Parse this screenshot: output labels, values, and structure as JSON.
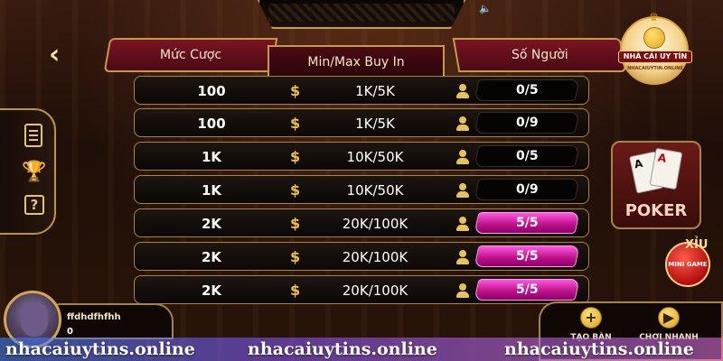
{
  "header": {
    "col_bet": "Mức Cược",
    "col_buyin": "Min/Max Buy In",
    "col_players": "Số Người"
  },
  "icons": {
    "back": "chevron-left-icon",
    "speaker": "speaker-icon",
    "document": "document-icon",
    "trophy": "trophy-icon",
    "help": "help-icon",
    "dollar": "dollar-icon",
    "person": "person-icon"
  },
  "rows": [
    {
      "bet": "100",
      "currency": "$",
      "buyin": "1K/5K",
      "players": "0/5",
      "full": false
    },
    {
      "bet": "100",
      "currency": "$",
      "buyin": "1K/5K",
      "players": "0/9",
      "full": false
    },
    {
      "bet": "1K",
      "currency": "$",
      "buyin": "10K/50K",
      "players": "0/5",
      "full": false
    },
    {
      "bet": "1K",
      "currency": "$",
      "buyin": "10K/50K",
      "players": "0/9",
      "full": false
    },
    {
      "bet": "2K",
      "currency": "$",
      "buyin": "20K/100K",
      "players": "5/5",
      "full": true
    },
    {
      "bet": "2K",
      "currency": "$",
      "buyin": "20K/100K",
      "players": "5/5",
      "full": true
    },
    {
      "bet": "2K",
      "currency": "$",
      "buyin": "20K/100K",
      "players": "5/5",
      "full": true
    }
  ],
  "logo": {
    "title": "NHÀ CÁI UY TÍN",
    "subtitle": "NHACAIUYTIN.ONLINE"
  },
  "poker": {
    "label": "POKER",
    "card1": "A",
    "card2": "A"
  },
  "minigame": {
    "xiu": "XỈU",
    "label": "MINI GAME"
  },
  "user": {
    "name": "ffdhdfhfhh",
    "balance": "0"
  },
  "actions": {
    "create_label": "TẠO BÀN",
    "quick_label": "CHƠI NHANH"
  },
  "watermark": {
    "text": "nhacaiuytins.online"
  },
  "colors": {
    "gold": "#c89a48",
    "header_red": "#7a1424",
    "full_pink": "#e028b0",
    "watermark_start": "#3c82ff",
    "watermark_end": "#e678e6"
  }
}
